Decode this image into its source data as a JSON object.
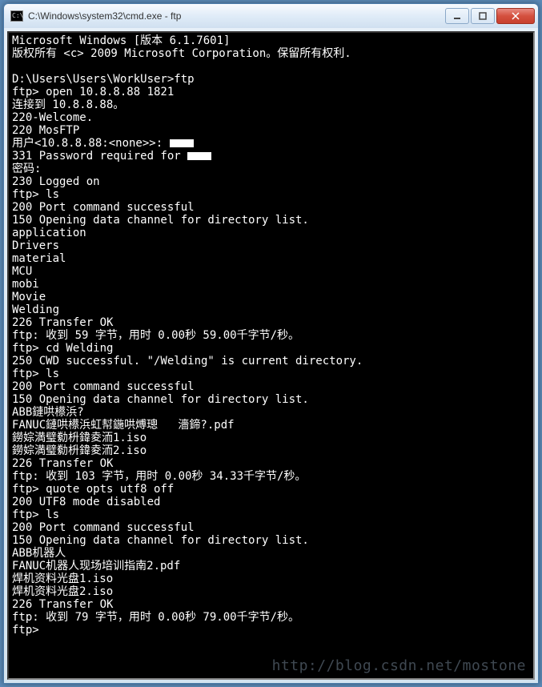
{
  "window": {
    "title": "C:\\Windows\\system32\\cmd.exe - ftp",
    "icon_label": "C:\\"
  },
  "terminal_lines": [
    "Microsoft Windows [版本 6.1.7601]",
    "版权所有 <c> 2009 Microsoft Corporation。保留所有权利.",
    "",
    "D:\\Users\\Users\\WorkUser>ftp",
    "ftp> open 10.8.8.88 1821",
    "连接到 10.8.8.88。",
    "220-Welcome.",
    "220 MosFTP",
    "用户<10.8.8.88:<none>>: ",
    "331 Password required for ",
    "密码:",
    "230 Logged on",
    "ftp> ls",
    "200 Port command successful",
    "150 Opening data channel for directory list.",
    "application",
    "Drivers",
    "material",
    "MCU",
    "mobi",
    "Movie",
    "Welding",
    "226 Transfer OK",
    "ftp: 收到 59 字节，用时 0.00秒 59.00千字节/秒。",
    "ftp> cd Welding",
    "250 CWD successful. \"/Welding\" is current directory.",
    "ftp> ls",
    "200 Port command successful",
    "150 Opening data channel for directory list.",
    "ABB鏈哄櫒浜?",
    "FANUC鏈哄櫒浜虹幇鍦哄煿璁   濇鍗?.pdf",
    "鐒婃満璧勬枡鍏夌洏1.iso",
    "鐒婃満璧勬枡鍏夌洏2.iso",
    "226 Transfer OK",
    "ftp: 收到 103 字节，用时 0.00秒 34.33千字节/秒。",
    "ftp> quote opts utf8 off",
    "200 UTF8 mode disabled",
    "ftp> ls",
    "200 Port command successful",
    "150 Opening data channel for directory list.",
    "ABB机器人",
    "FANUC机器人现场培训指南2.pdf",
    "焊机资料光盘1.iso",
    "焊机资料光盘2.iso",
    "226 Transfer OK",
    "ftp: 收到 79 字节，用时 0.00秒 79.00千字节/秒。",
    "ftp>"
  ],
  "redacted_line_indices": [
    8,
    9
  ],
  "watermark": "http://blog.csdn.net/mostone"
}
